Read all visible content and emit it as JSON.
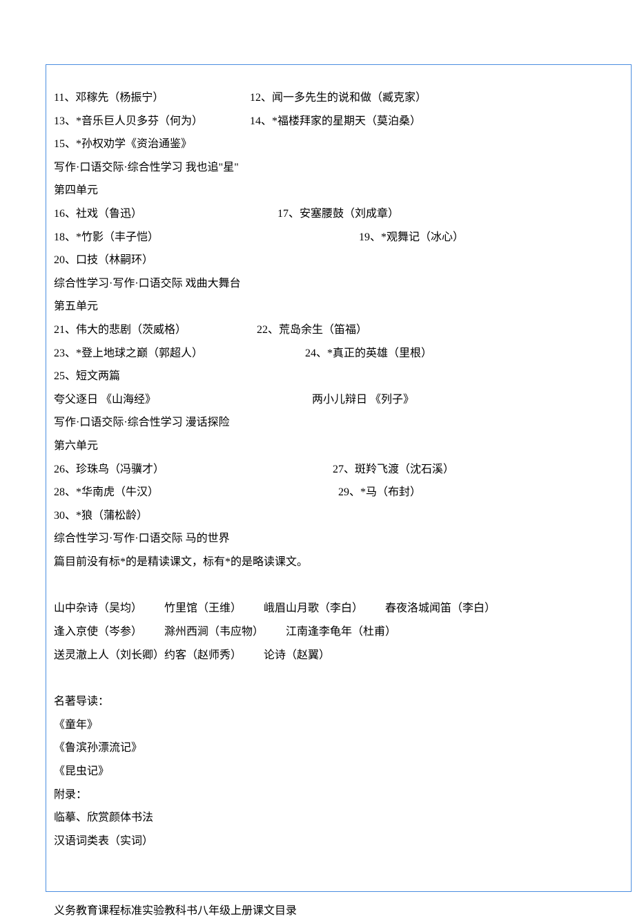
{
  "body": {
    "l11": "11、邓稼先（杨振宁）",
    "l12": "12、闻一多先生的说和做（臧克家）",
    "l13": "13、*音乐巨人贝多芬（何为）",
    "l14": "14、*福楼拜家的星期天（莫泊桑）",
    "l15": "15、*孙权劝学《资治通鉴》",
    "act3": "写作·口语交际·综合性学习   我也追\"星\"",
    "u4": "第四单元",
    "l16": "16、社戏（鲁迅）",
    "l17": "17、安塞腰鼓（刘成章）",
    "l18": "18、*竹影（丰子恺）",
    "l19": "19、*观舞记（冰心）",
    "l20": "20、口技（林嗣环）",
    "act4": "综合性学习·写作·口语交际   戏曲大舞台",
    "u5": "第五单元",
    "l21": "21、伟大的悲剧（茨威格）",
    "l22": "22、荒岛余生（笛福）",
    "l23": "23、*登上地球之巅（郭超人）",
    "l24": "24、*真正的英雄（里根）",
    "l25": "25、短文两篇",
    "kua": "夸父逐日   《山海经》",
    "liang": "两小儿辩日   《列子》",
    "act5": "写作·口语交际·综合性学习   漫话探险",
    "u6": "第六单元",
    "l26": "26、珍珠鸟（冯骥才）",
    "l27": "27、斑羚飞渡（沈石溪）",
    "l28": "28、*华南虎（牛汉）",
    "l29": "29、*马（布封）",
    "l30": "30、*狼（蒲松龄）",
    "act6": "综合性学习·写作·口语交际   马的世界",
    "note": "篇目前没有标*的是精读课文，标有*的是略读课文。",
    "p1a": "山中杂诗（吴均）",
    "p1b": "竹里馆（王维）",
    "p1c": "峨眉山月歌（李白）",
    "p1d": "春夜洛城闻笛（李白）",
    "p2a": "逢入京使（岑参）",
    "p2b": "滁州西涧（韦应物）",
    "p2c": "江南逢李龟年（杜甫）",
    "p3a": "送灵澈上人（刘长卿）约客（赵师秀）",
    "p3b": "论诗（赵翼）",
    "mzdd": "名著导读：",
    "mz1": "《童年》",
    "mz2": "《鲁滨孙漂流记》",
    "mz3": "《昆虫记》",
    "fl": "附录：",
    "fl1": "临摹、欣赏颜体书法",
    "fl2": "汉语词类表（实词）",
    "next": "义务教育课程标准实验教科书八年级上册课文目录"
  }
}
